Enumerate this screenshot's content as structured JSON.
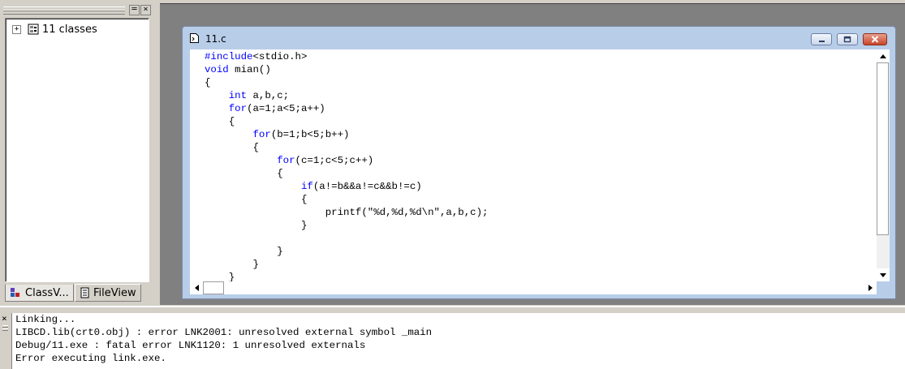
{
  "workspace": {
    "tree": {
      "expander": "+",
      "icon": "class-folder-icon",
      "label": "11 classes"
    },
    "tabs": [
      {
        "label": "ClassV...",
        "icon": "classview-icon"
      },
      {
        "label": "FileView",
        "icon": "fileview-icon"
      }
    ],
    "close_glyph": "×"
  },
  "editor": {
    "title": "11.c",
    "code_lines": [
      "#include<stdio.h>",
      "void mian()",
      "{",
      "    int a,b,c;",
      "    for(a=1;a<5;a++)",
      "    {",
      "        for(b=1;b<5;b++)",
      "        {",
      "            for(c=1;c<5;c++)",
      "            {",
      "                if(a!=b&&a!=c&&b!=c)",
      "                {",
      "                    printf(\"%d,%d,%d\\n\",a,b,c);",
      "                }",
      "",
      "            }",
      "        }",
      "    }"
    ],
    "keywords": [
      "#include",
      "void",
      "int",
      "for",
      "if"
    ]
  },
  "output": {
    "close_glyph": "×",
    "lines": [
      "Linking...",
      "LIBCD.lib(crt0.obj) : error LNK2001: unresolved external symbol _main",
      "Debug/11.exe : fatal error LNK1120: 1 unresolved externals",
      "Error executing link.exe."
    ]
  }
}
